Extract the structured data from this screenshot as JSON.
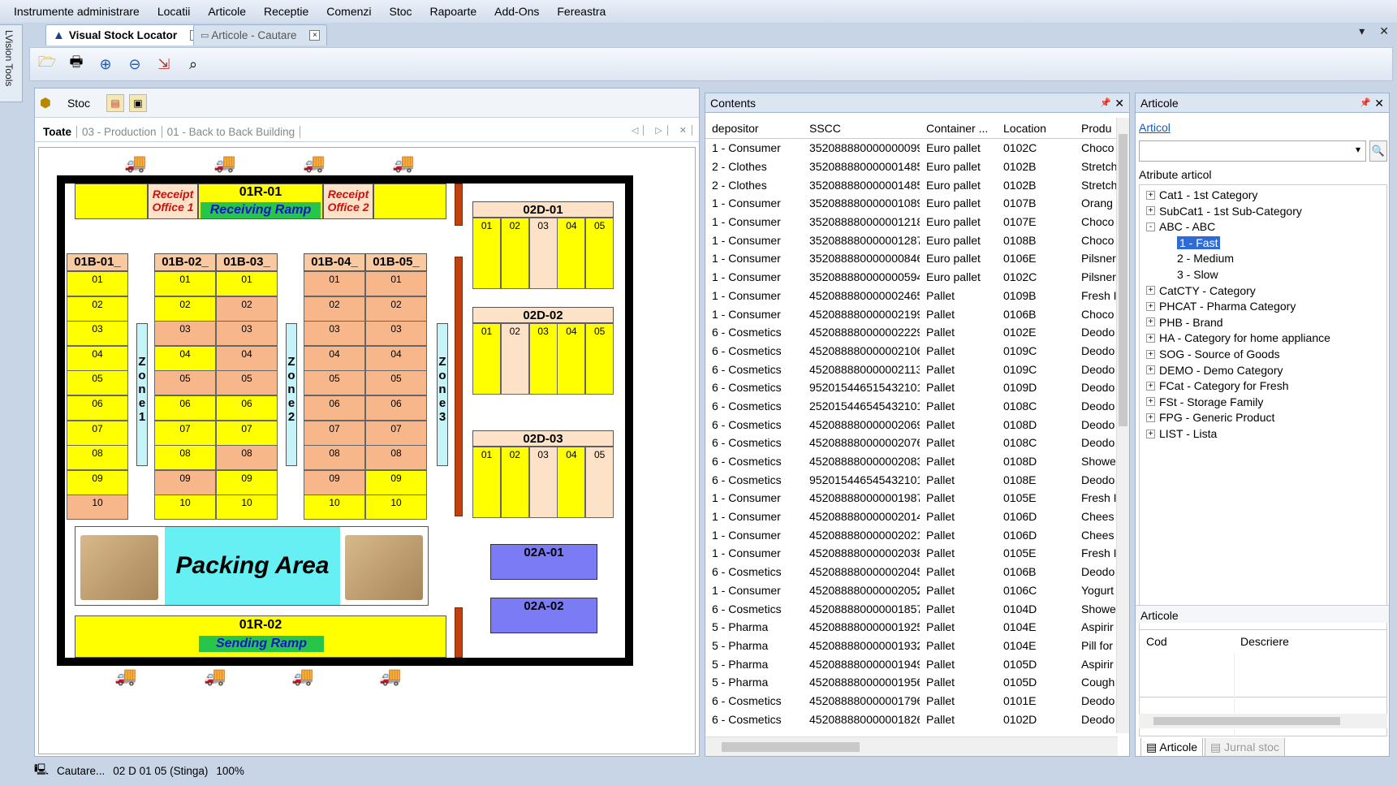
{
  "menu": [
    "Instrumente administrare",
    "Locatii",
    "Articole",
    "Receptie",
    "Comenzi",
    "Stoc",
    "Rapoarte",
    "Add-Ons",
    "Fereastra"
  ],
  "side_tab": "LVision Tools",
  "doc_tabs": [
    {
      "label": "Visual Stock Locator",
      "icon": "warning-triangle-icon",
      "active": true
    },
    {
      "label": "Articole - Cautare",
      "icon": "window-icon",
      "active": false
    }
  ],
  "tab_close_glyph": "×",
  "toolbar_icons": [
    "open-folder-icon",
    "print-icon",
    "zoom-in-icon",
    "zoom-out-icon",
    "export-icon",
    "search-icon"
  ],
  "left": {
    "tool_label": "Stoc",
    "subtabs": [
      "Toate",
      "03 - Production",
      "01 - Back to Back Building"
    ]
  },
  "map": {
    "receipt_office_1": "Receipt Office 1",
    "receipt_office_2": "Receipt Office 2",
    "receiving_code": "01R-01",
    "receiving_name": "Receiving Ramp",
    "sending_code": "01R-02",
    "sending_name": "Sending Ramp",
    "packing": "Packing Area",
    "zones": [
      "Zone 1",
      "Zone 2",
      "Zone 3"
    ],
    "racks": [
      {
        "code": "01B-01_",
        "levels": [
          "01",
          "02",
          "03",
          "04",
          "05",
          "06",
          "07",
          "08",
          "09",
          "10"
        ],
        "fill": [
          "y",
          "y",
          "y",
          "y",
          "y",
          "y",
          "y",
          "y",
          "y",
          "o"
        ]
      },
      {
        "code": "01B-02_",
        "levels": [
          "01",
          "02",
          "03",
          "04",
          "05",
          "06",
          "07",
          "08",
          "09",
          "10"
        ],
        "fill": [
          "y",
          "y",
          "o",
          "y",
          "o",
          "y",
          "y",
          "y",
          "o",
          "y"
        ]
      },
      {
        "code": "01B-03_",
        "levels": [
          "01",
          "02",
          "03",
          "04",
          "05",
          "06",
          "07",
          "08",
          "09",
          "10"
        ],
        "fill": [
          "y",
          "o",
          "o",
          "o",
          "o",
          "y",
          "y",
          "o",
          "y",
          "y"
        ]
      },
      {
        "code": "01B-04_",
        "levels": [
          "01",
          "02",
          "03",
          "04",
          "05",
          "06",
          "07",
          "08",
          "09",
          "10"
        ],
        "fill": [
          "o",
          "o",
          "o",
          "o",
          "o",
          "o",
          "o",
          "o",
          "o",
          "y"
        ]
      },
      {
        "code": "01B-05_",
        "levels": [
          "01",
          "02",
          "03",
          "04",
          "05",
          "06",
          "07",
          "08",
          "09",
          "10"
        ],
        "fill": [
          "o",
          "o",
          "o",
          "o",
          "o",
          "o",
          "o",
          "o",
          "y",
          "y"
        ]
      }
    ],
    "dracks": [
      {
        "code": "02D-01",
        "cols": [
          "01",
          "02",
          "03",
          "04",
          "05"
        ],
        "fill": [
          "y",
          "y",
          "p",
          "y",
          "y"
        ]
      },
      {
        "code": "02D-02",
        "cols": [
          "01",
          "02",
          "03",
          "04",
          "05"
        ],
        "fill": [
          "y",
          "p",
          "y",
          "y",
          "y"
        ]
      },
      {
        "code": "02D-03",
        "cols": [
          "01",
          "02",
          "03",
          "04",
          "05"
        ],
        "fill": [
          "y",
          "y",
          "p",
          "y",
          "p"
        ]
      }
    ],
    "areas": [
      "02A-01",
      "02A-02"
    ]
  },
  "status": {
    "text": "Cautare...",
    "location": "02 D 01 05 (Stinga)",
    "zoom": "100%"
  },
  "contents": {
    "title": "Contents",
    "columns": [
      "depositor",
      "SSCC",
      "Container ...",
      "Location",
      "Produ"
    ],
    "rows": [
      [
        "1 - Consumer",
        "352088880000000099",
        "Euro pallet",
        "0102C",
        "Choco"
      ],
      [
        "2 - Clothes",
        "352088880000001485",
        "Euro pallet",
        "0102B",
        "Stretch"
      ],
      [
        "2 - Clothes",
        "352088880000001485",
        "Euro pallet",
        "0102B",
        "Stretch"
      ],
      [
        "1 - Consumer",
        "352088880000001089",
        "Euro pallet",
        "0107B",
        "Orang"
      ],
      [
        "1 - Consumer",
        "352088880000001218",
        "Euro pallet",
        "0107E",
        "Choco"
      ],
      [
        "1 - Consumer",
        "352088880000001287",
        "Euro pallet",
        "0108B",
        "Choco"
      ],
      [
        "1 - Consumer",
        "352088880000000846",
        "Euro pallet",
        "0106E",
        "Pilsner"
      ],
      [
        "1 - Consumer",
        "352088880000000594",
        "Euro pallet",
        "0102C",
        "Pilsner"
      ],
      [
        "1 - Consumer",
        "452088880000002465",
        "Pallet",
        "0109B",
        "Fresh I"
      ],
      [
        "1 - Consumer",
        "452088880000002199",
        "Pallet",
        "0106B",
        "Choco"
      ],
      [
        "6 - Cosmetics",
        "452088880000002229",
        "Pallet",
        "0102E",
        "Deodo"
      ],
      [
        "6 - Cosmetics",
        "452088880000002106",
        "Pallet",
        "0109C",
        "Deodo"
      ],
      [
        "6 - Cosmetics",
        "452088880000002113",
        "Pallet",
        "0109C",
        "Deodo"
      ],
      [
        "6 - Cosmetics",
        "952015446515432101",
        "Pallet",
        "0109D",
        "Deodo"
      ],
      [
        "6 - Cosmetics",
        "252015446545432101",
        "Pallet",
        "0108C",
        "Deodo"
      ],
      [
        "6 - Cosmetics",
        "452088880000002069",
        "Pallet",
        "0108D",
        "Deodo"
      ],
      [
        "6 - Cosmetics",
        "452088880000002076",
        "Pallet",
        "0108C",
        "Deodo"
      ],
      [
        "6 - Cosmetics",
        "452088880000002083",
        "Pallet",
        "0108D",
        "Showe"
      ],
      [
        "6 - Cosmetics",
        "952015446545432101",
        "Pallet",
        "0108E",
        "Deodo"
      ],
      [
        "1 - Consumer",
        "452088880000001987",
        "Pallet",
        "0105E",
        "Fresh I"
      ],
      [
        "1 - Consumer",
        "452088880000002014",
        "Pallet",
        "0106D",
        "Chees"
      ],
      [
        "1 - Consumer",
        "452088880000002021",
        "Pallet",
        "0106D",
        "Chees"
      ],
      [
        "1 - Consumer",
        "452088880000002038",
        "Pallet",
        "0105E",
        "Fresh I"
      ],
      [
        "6 - Cosmetics",
        "452088880000002045",
        "Pallet",
        "0106B",
        "Deodo"
      ],
      [
        "1 - Consumer",
        "452088880000002052",
        "Pallet",
        "0106C",
        "Yogurt"
      ],
      [
        "6 - Cosmetics",
        "452088880000001857",
        "Pallet",
        "0104D",
        "Showe"
      ],
      [
        "5 - Pharma",
        "452088880000001925",
        "Pallet",
        "0104E",
        "Aspirir"
      ],
      [
        "5 - Pharma",
        "452088880000001932",
        "Pallet",
        "0104E",
        "Pill for"
      ],
      [
        "5 - Pharma",
        "452088880000001949",
        "Pallet",
        "0105D",
        "Aspirir"
      ],
      [
        "5 - Pharma",
        "452088880000001956",
        "Pallet",
        "0105D",
        "Cough"
      ],
      [
        "6 - Cosmetics",
        "452088880000001796",
        "Pallet",
        "0101E",
        "Deodo"
      ],
      [
        "6 - Cosmetics",
        "452088880000001826",
        "Pallet",
        "0102D",
        "Deodo"
      ]
    ]
  },
  "articole": {
    "title": "Articole",
    "link": "Articol",
    "attr_label": "Atribute articol",
    "tree": [
      {
        "label": "Cat1 - 1st Category",
        "level": 0,
        "exp": "+"
      },
      {
        "label": "SubCat1 - 1st Sub-Category",
        "level": 0,
        "exp": "+"
      },
      {
        "label": "ABC - ABC",
        "level": 0,
        "exp": "-"
      },
      {
        "label": "1 - Fast",
        "level": 1,
        "sel": true
      },
      {
        "label": "2 - Medium",
        "level": 1
      },
      {
        "label": "3 - Slow",
        "level": 1
      },
      {
        "label": "CatCTY - Category",
        "level": 0,
        "exp": "+"
      },
      {
        "label": "PHCAT - Pharma Category",
        "level": 0,
        "exp": "+"
      },
      {
        "label": "PHB - Brand",
        "level": 0,
        "exp": "+"
      },
      {
        "label": "HA - Category for home appliance",
        "level": 0,
        "exp": "+"
      },
      {
        "label": "SOG - Source of Goods",
        "level": 0,
        "exp": "+"
      },
      {
        "label": "DEMO - Demo Category",
        "level": 0,
        "exp": "+"
      },
      {
        "label": "FCat - Category for Fresh",
        "level": 0,
        "exp": "+"
      },
      {
        "label": "FSt - Storage Family",
        "level": 0,
        "exp": "+"
      },
      {
        "label": "FPG - Generic Product",
        "level": 0,
        "exp": "+"
      },
      {
        "label": "LIST - Lista",
        "level": 0,
        "exp": "+"
      }
    ],
    "sub_title": "Articole",
    "grid_cols": [
      "Cod",
      "Descriere"
    ],
    "bottom_tabs": [
      "Articole",
      "Jurnal stoc"
    ]
  },
  "colors": {
    "yellow": "#ffff00",
    "orange": "#f7b78a",
    "peach": "#fde2c7",
    "zone": "#c5f3f8",
    "blue_area": "#7b7bf5",
    "wall_red": "#c2410c"
  }
}
